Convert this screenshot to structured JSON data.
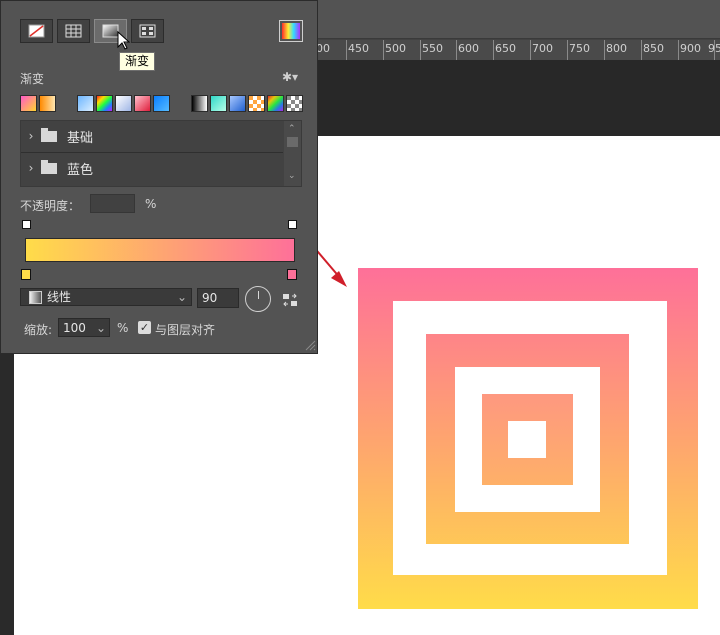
{
  "ruler": {
    "labels": [
      "00",
      "450",
      "500",
      "550",
      "600",
      "650",
      "700",
      "750",
      "800",
      "850",
      "900",
      "95"
    ]
  },
  "panel": {
    "tooltip": "渐变",
    "section_title": "渐变",
    "folders": [
      "基础",
      "蓝色"
    ],
    "opacity_label": "不透明度：",
    "opacity_unit": "%",
    "gradient": {
      "start_color": "#ffdc49",
      "end_color": "#fe7099"
    },
    "type_value": "线性",
    "angle_value": "90",
    "scale_label": "缩放:",
    "scale_value": "100",
    "scale_unit": "%",
    "align_label": "与图层对齐",
    "align_checked": "✓"
  },
  "colors": {
    "panel_bg": "#535353",
    "artwork_top": "#fe7099",
    "artwork_bottom": "#ffdc49",
    "arrow": "#d01f2a"
  },
  "icons": [
    "no-fill-icon",
    "solid-color-icon",
    "gradient-icon",
    "pattern-icon",
    "color-picker-icon",
    "gear-icon",
    "folder-icon",
    "reverse-gradient-icon",
    "cursor-icon"
  ]
}
